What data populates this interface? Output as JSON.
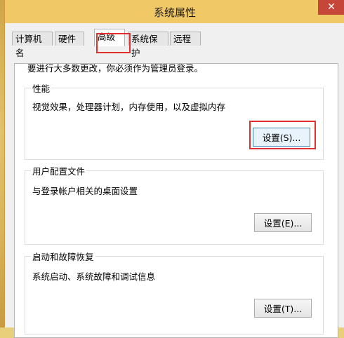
{
  "window": {
    "title": "系统属性",
    "close_glyph": "✕"
  },
  "tabs": [
    {
      "label": "计算机名",
      "active": false
    },
    {
      "label": "硬件",
      "active": false
    },
    {
      "label": "高级",
      "active": true
    },
    {
      "label": "系统保护",
      "active": false
    },
    {
      "label": "远程",
      "active": false
    }
  ],
  "advanced": {
    "intro": "要进行大多数更改，你必须作为管理员登录。",
    "performance": {
      "label": "性能",
      "description": "视觉效果，处理器计划，内存使用，以及虚拟内存",
      "button": "设置(S)..."
    },
    "user_profiles": {
      "label": "用户配置文件",
      "description": "与登录帐户相关的桌面设置",
      "button": "设置(E)..."
    },
    "startup_recovery": {
      "label": "启动和故障恢复",
      "description": "系统启动、系统故障和调试信息",
      "button": "设置(T)..."
    }
  },
  "colors": {
    "highlight": "#e03030",
    "title_bar": "#f0c866",
    "close_button": "#c7463a"
  },
  "icons": {
    "close": "close-icon"
  }
}
